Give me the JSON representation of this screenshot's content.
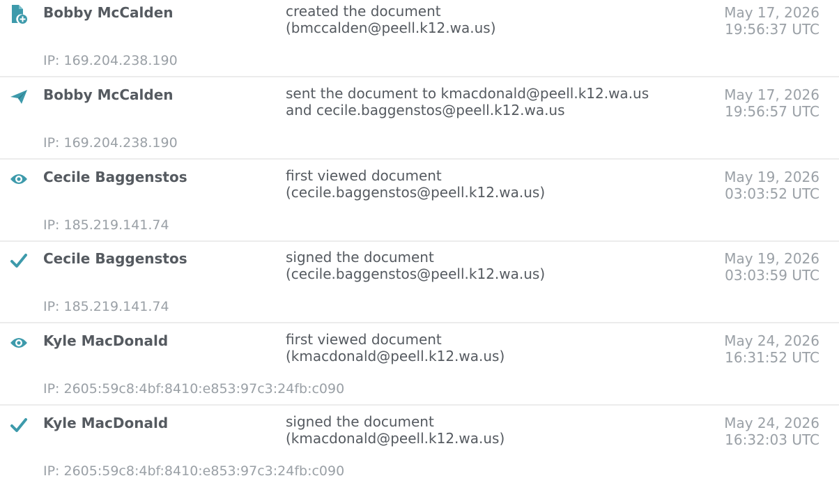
{
  "colors": {
    "icon_teal": "#3d9aab",
    "text_dark": "#555a60",
    "text_muted": "#9aa0a6",
    "divider": "#ececec"
  },
  "entries": [
    {
      "icon": "document-add-icon",
      "name": "Bobby McCalden",
      "action_line1": "created the document",
      "action_line2": "(bmccalden@peell.k12.wa.us)",
      "date": "May 17, 2026",
      "time": "19:56:37 UTC",
      "ip": "IP: 169.204.238.190"
    },
    {
      "icon": "send-icon",
      "name": "Bobby McCalden",
      "action_line1": "sent the document to kmacdonald@peell.k12.wa.us",
      "action_line2": "and cecile.baggenstos@peell.k12.wa.us",
      "date": "May 17, 2026",
      "time": "19:56:57 UTC",
      "ip": "IP: 169.204.238.190"
    },
    {
      "icon": "eye-icon",
      "name": "Cecile Baggenstos",
      "action_line1": "first viewed document",
      "action_line2": "(cecile.baggenstos@peell.k12.wa.us)",
      "date": "May 19, 2026",
      "time": "03:03:52 UTC",
      "ip": "IP: 185.219.141.74"
    },
    {
      "icon": "checkmark-icon",
      "name": "Cecile Baggenstos",
      "action_line1": "signed the document",
      "action_line2": "(cecile.baggenstos@peell.k12.wa.us)",
      "date": "May 19, 2026",
      "time": "03:03:59 UTC",
      "ip": "IP: 185.219.141.74"
    },
    {
      "icon": "eye-icon",
      "name": "Kyle MacDonald",
      "action_line1": "first viewed document",
      "action_line2": "(kmacdonald@peell.k12.wa.us)",
      "date": "May 24, 2026",
      "time": "16:31:52 UTC",
      "ip": "IP: 2605:59c8:4bf:8410:e853:97c3:24fb:c090"
    },
    {
      "icon": "checkmark-icon",
      "name": "Kyle MacDonald",
      "action_line1": "signed the document",
      "action_line2": "(kmacdonald@peell.k12.wa.us)",
      "date": "May 24, 2026",
      "time": "16:32:03 UTC",
      "ip": "IP: 2605:59c8:4bf:8410:e853:97c3:24fb:c090"
    }
  ]
}
